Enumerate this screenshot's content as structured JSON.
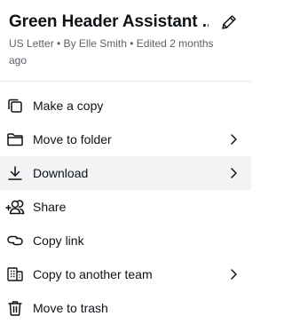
{
  "header": {
    "title": "Green Header Assistant ...",
    "meta": "US Letter • By Elle Smith • Edited 2 months ago",
    "edit_icon": "pencil-icon"
  },
  "menu": {
    "items": [
      {
        "label": "Make a copy",
        "icon": "copy-icon",
        "has_submenu": false
      },
      {
        "label": "Move to folder",
        "icon": "folder-icon",
        "has_submenu": true
      },
      {
        "label": "Download",
        "icon": "download-icon",
        "has_submenu": true,
        "hovered": true
      },
      {
        "label": "Share",
        "icon": "share-people-icon",
        "has_submenu": false
      },
      {
        "label": "Copy link",
        "icon": "link-icon",
        "has_submenu": false
      },
      {
        "label": "Copy to another team",
        "icon": "building-icon",
        "has_submenu": true
      },
      {
        "label": "Move to trash",
        "icon": "trash-icon",
        "has_submenu": false
      }
    ]
  },
  "colors": {
    "text": "#0e1318",
    "meta_text": "#5c636b",
    "hover_bg": "#f2f3f5",
    "divider": "#e3e5e8"
  }
}
